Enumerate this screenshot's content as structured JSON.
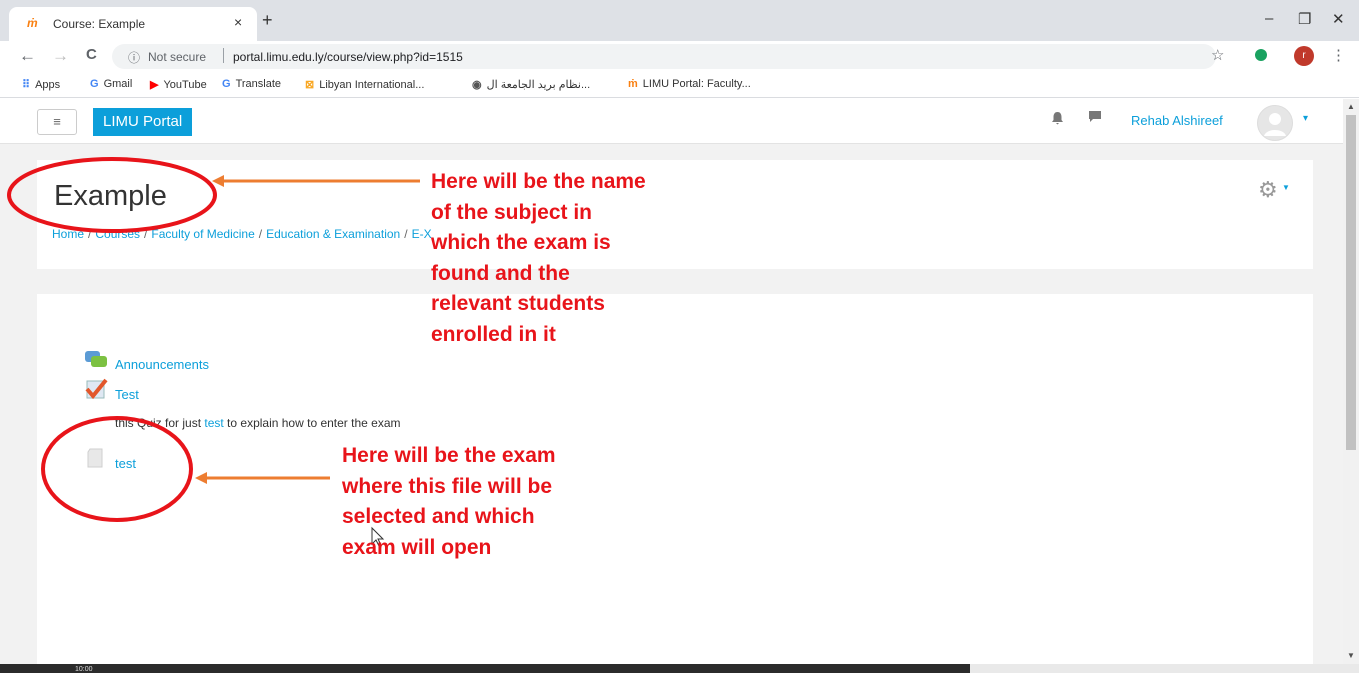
{
  "browser": {
    "tab_title": "Course: Example",
    "tab_close": "×",
    "new_tab": "+",
    "favicon": "ṁ",
    "window_controls": {
      "minimize": "–",
      "restore": "❐",
      "close": "✕"
    },
    "back": "←",
    "forward": "→",
    "reload": "C",
    "not_secure": "Not secure",
    "url": "portal.limu.edu.ly/course/view.php?id=1515",
    "profile_initial": "r"
  },
  "bookmarks": [
    {
      "icon": "apps-icon",
      "glyph": "⠿",
      "label": "Apps",
      "color": "#4285f4"
    },
    {
      "icon": "google-icon",
      "glyph": "G",
      "label": "Gmail",
      "color": "#4285f4"
    },
    {
      "icon": "youtube-icon",
      "glyph": "▶",
      "label": "YouTube",
      "color": "#ff0000"
    },
    {
      "icon": "translate-icon",
      "glyph": "G",
      "label": "Translate",
      "color": "#4285f4"
    },
    {
      "icon": "libyan-icon",
      "glyph": "⊠",
      "label": "Libyan International...",
      "color": "#f9a825"
    },
    {
      "icon": "globe-icon",
      "glyph": "◉",
      "label": "نظام بريد الجامعة ال...",
      "color": "#555555"
    },
    {
      "icon": "moodle-icon",
      "glyph": "ṁ",
      "label": "LIMU Portal: Faculty...",
      "color": "#f98012"
    }
  ],
  "navbar": {
    "menu_glyph": "≡",
    "brand": "LIMU Portal",
    "bell_glyph": "🔔",
    "chat_glyph": "▬",
    "user_name": "Rehab Alshireef",
    "caret": "▾"
  },
  "header": {
    "title": "Example",
    "breadcrumb": [
      "Home",
      "Courses",
      "Faculty of Medicine",
      "Education & Examination",
      "E-X"
    ],
    "gear_glyph": "⚙"
  },
  "activities": [
    {
      "label": "Announcements",
      "icon": "forum-icon"
    },
    {
      "label": "Test",
      "icon": "quiz-icon"
    },
    {
      "label": "test",
      "icon": "file-icon"
    }
  ],
  "summary": {
    "prefix": "this Quiz for just ",
    "link": "test",
    "suffix": " to explain how to enter the exam"
  },
  "taskbar": {
    "clock": "10:00"
  },
  "annotations": {
    "title_note": [
      "Here will be the name",
      "of the subject in",
      "which the exam is",
      "found and the",
      "relevant students",
      "enrolled in it"
    ],
    "exam_note": [
      "Here will be the exam",
      "where this file will be",
      "selected and which",
      "exam will open"
    ],
    "color": "#e8141a"
  }
}
